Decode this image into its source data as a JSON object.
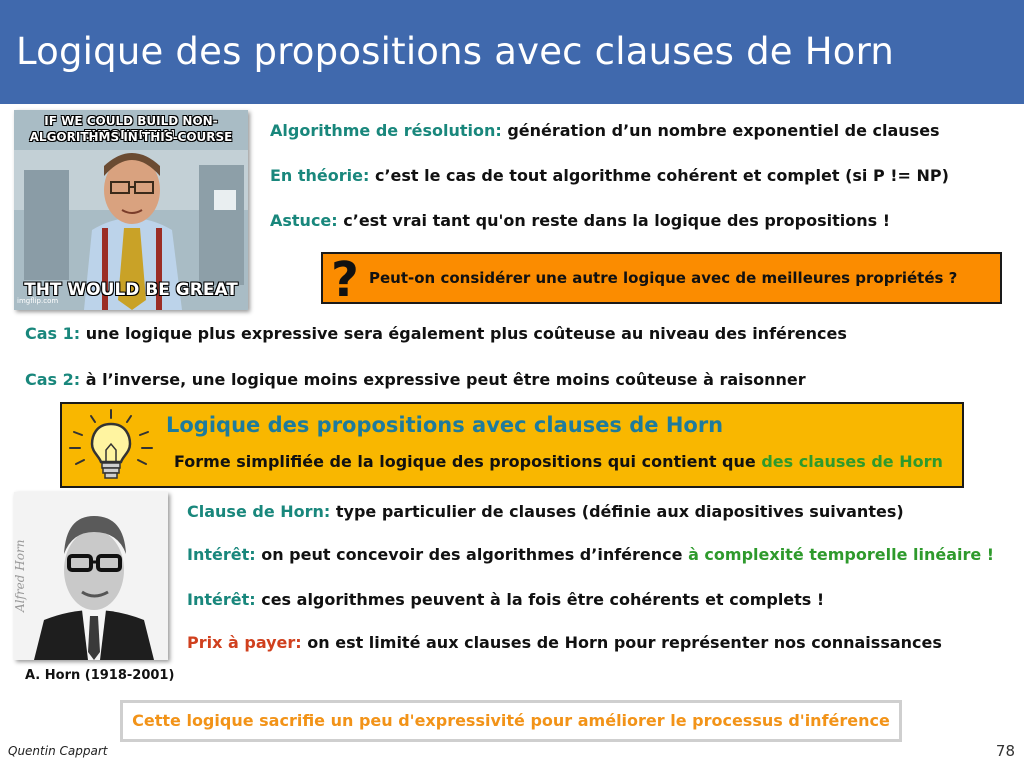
{
  "slide": {
    "title": "Logique des propositions avec clauses de Horn",
    "author": "Quentin Cappart",
    "page_number": "78"
  },
  "meme": {
    "top_text_1": "IF WE COULD BUILD NON-EXPONENTIAL",
    "top_text_2": "ALGORITHMS IN THIS COURSE",
    "bottom_text": "THT WOULD BE GREAT",
    "watermark": "imgflip.com"
  },
  "intro": [
    {
      "label": "Algorithme de résolution:",
      "text": " génération d’un nombre exponentiel de clauses"
    },
    {
      "label": "En théorie:",
      "text": " c’est le cas de tout algorithme cohérent et complet (si P != NP)"
    },
    {
      "label": "Astuce:",
      "text": " c’est vrai tant qu'on reste dans la logique des propositions !"
    }
  ],
  "question_box": {
    "icon": "question-mark-icon",
    "mark": "?",
    "text": "Peut-on considérer une autre logique avec de meilleures propriétés ?"
  },
  "cases": [
    {
      "label": "Cas 1:",
      "text": " une logique plus expressive sera également plus coûteuse au niveau des inférences"
    },
    {
      "label": "Cas 2:",
      "text": " à l’inverse, une logique moins expressive peut être moins coûteuse à raisonner"
    }
  ],
  "highlight_box": {
    "icon": "lightbulb-icon",
    "title": "Logique des propositions avec clauses de Horn",
    "text": "Forme simplifiée de la logique des propositions qui contient que ",
    "text_highlight": "des clauses de Horn"
  },
  "horn_points": [
    {
      "label": "Clause de Horn:",
      "text": " type particulier de clauses (définie aux diapositives suivantes)"
    },
    {
      "label": "Intérêt:",
      "text": " on peut concevoir des algorithmes d’inférence ",
      "highlight": "à complexité temporelle linéaire !"
    },
    {
      "label": "Intérêt:",
      "text": " ces algorithmes peuvent à la fois être cohérents et complets !"
    },
    {
      "label": "Prix à payer:",
      "text": " on est limité aux clauses de Horn pour représenter nos connaissances"
    }
  ],
  "photo": {
    "caption": "A. Horn (1918-2001)",
    "signature": "Alfred Horn"
  },
  "conclusion": "Cette logique sacrifie un peu d'expressivité pour améliorer le processus d'inférence",
  "colors": {
    "header": "#4069ad",
    "label": "#19877c",
    "highlight_green": "#2e9a2c",
    "price_red": "#d0401e",
    "question_box": "#fb8c00",
    "idea_box": "#f9b700",
    "idea_title": "#1e7b9c",
    "conclusion_text": "#f29318"
  }
}
